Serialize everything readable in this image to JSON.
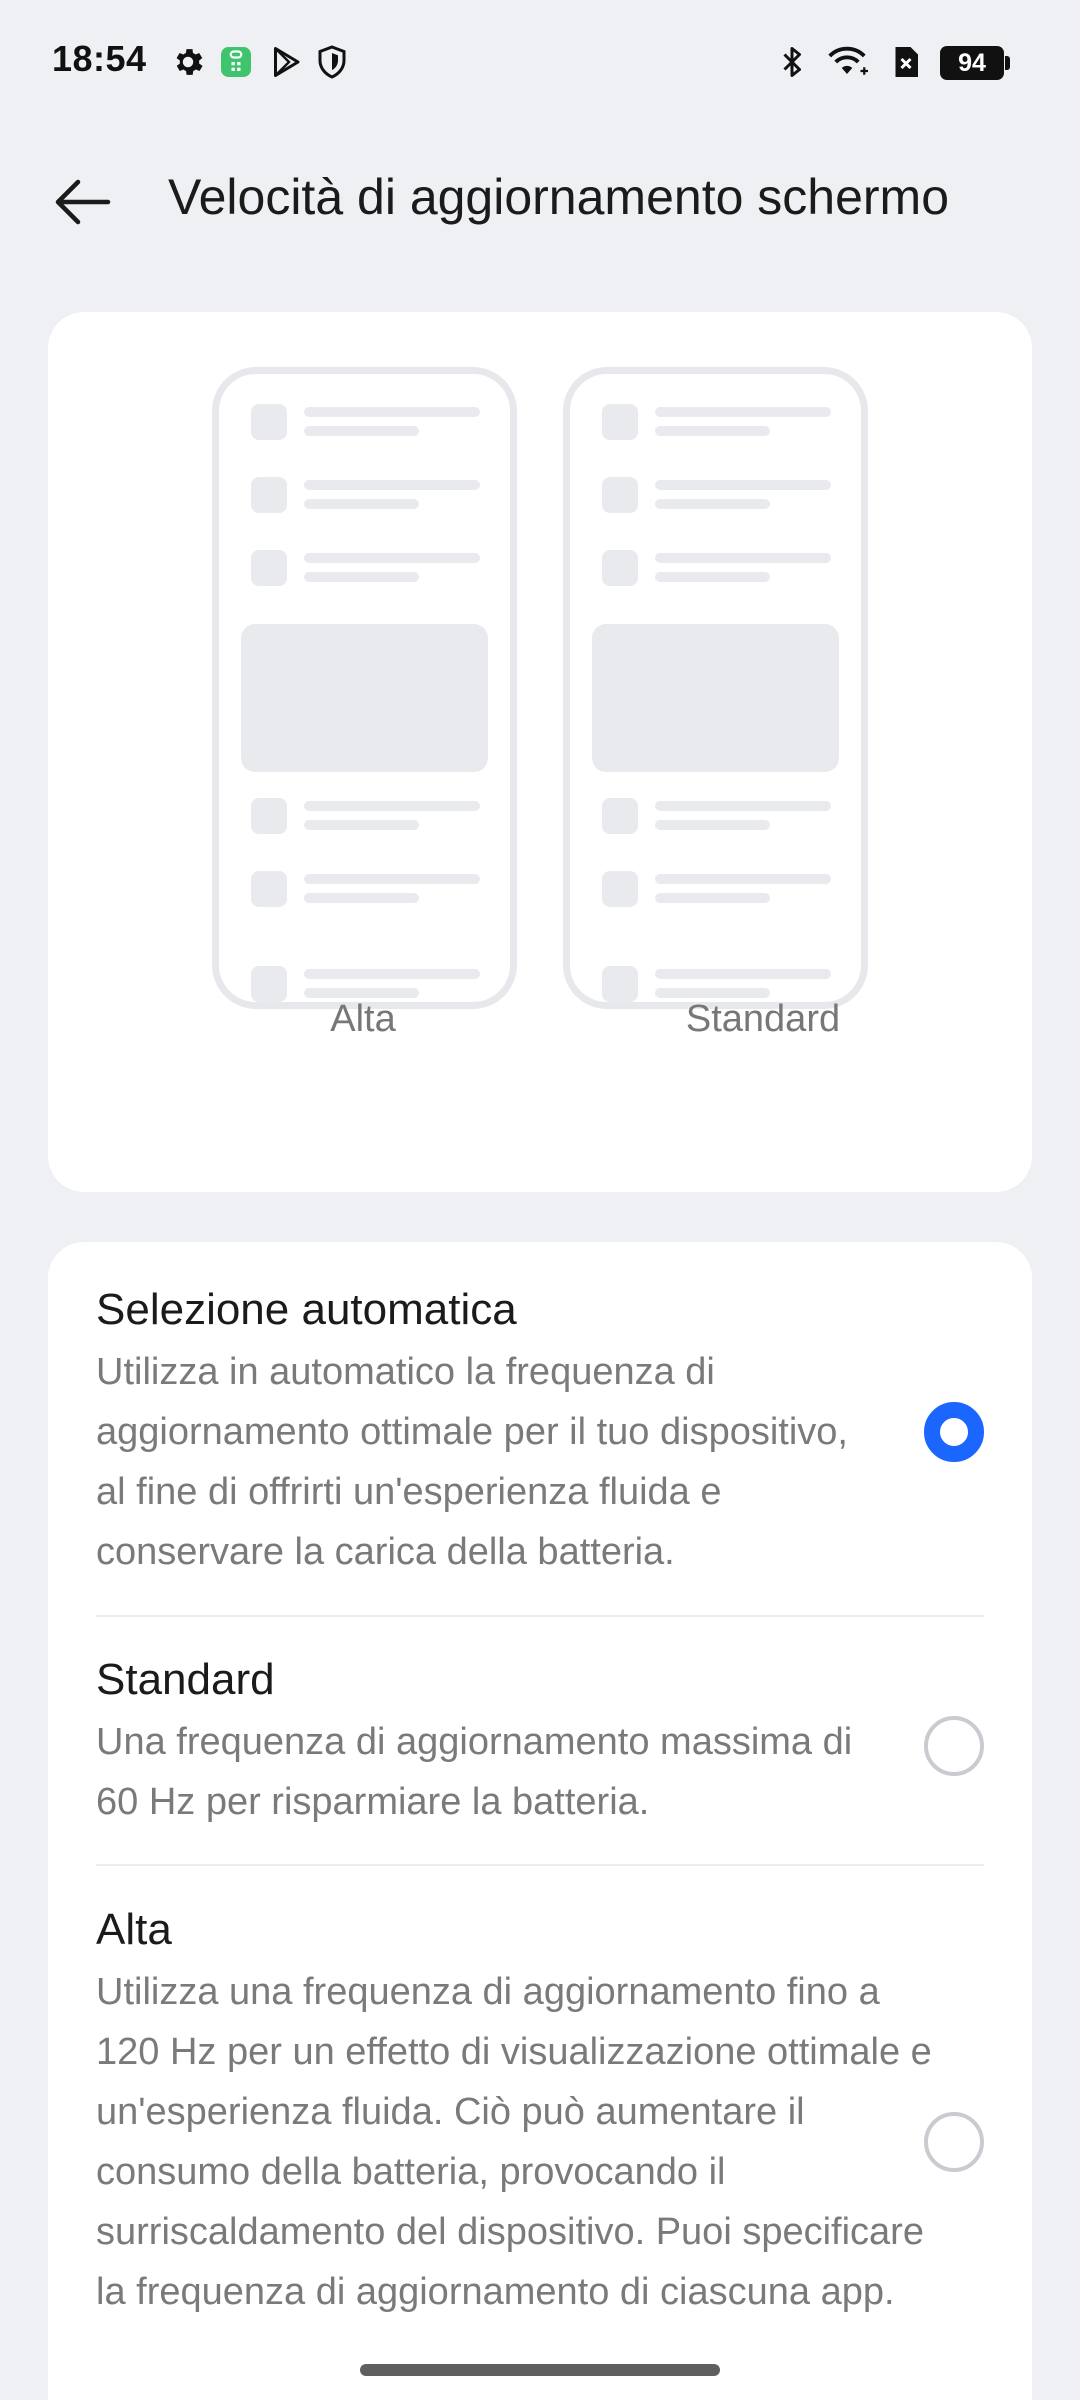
{
  "status_bar": {
    "time": "18:54",
    "icons": [
      "gear-icon",
      "app-store-icon",
      "play-store-icon",
      "shield-icon",
      "bluetooth-icon",
      "wifi-icon",
      "no-sim-icon"
    ],
    "battery": "94"
  },
  "header": {
    "title": "Velocità di aggiornamento schermo",
    "back_icon": "arrow-left-icon"
  },
  "preview": {
    "alta_label": "Alta",
    "standard_label": "Standard"
  },
  "options": [
    {
      "title": "Selezione automatica",
      "description": "Utilizza in automatico la frequenza di aggiornamento ottimale per il tuo dispositivo, al fine di offrirti un'esperienza fluida e conservare la carica della batteria.",
      "selected": true
    },
    {
      "title": "Standard",
      "description": "Una frequenza di aggiornamento massima di 60 Hz per risparmiare la batteria.",
      "selected": false
    },
    {
      "title": "Alta",
      "description": "Utilizza una frequenza di aggiornamento fino a 120 Hz per un effetto di visualizzazione ottimale e un'esperienza fluida. Ciò può aumentare il consumo della batteria, provocando il surriscaldamento del dispositivo. Puoi specificare la frequenza di aggiornamento di ciascuna app.",
      "selected": false
    }
  ],
  "colors": {
    "accent": "#1a66ff",
    "background": "#eef0f3",
    "card": "#ffffff"
  }
}
